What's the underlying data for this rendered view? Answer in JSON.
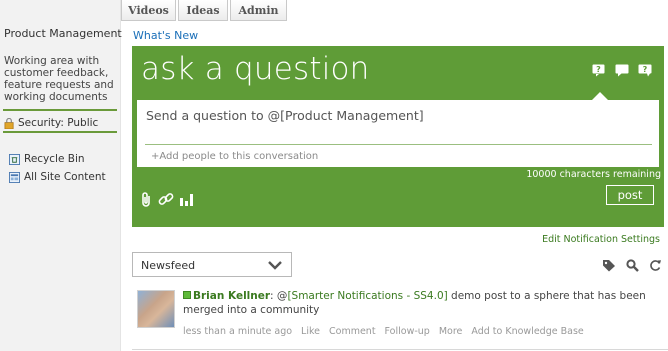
{
  "sidebar": {
    "title": "Product Management",
    "description": "Working area with customer feedback, feature requests and working documents",
    "security": "Security: Public",
    "links": [
      {
        "label": "Recycle Bin",
        "icon": "recycle-bin-icon"
      },
      {
        "label": "All Site Content",
        "icon": "site-content-icon"
      }
    ]
  },
  "tabs": [
    "Videos",
    "Ideas",
    "Admin"
  ],
  "whats_new": "What's New",
  "composer": {
    "heading": "ask a question",
    "placeholder": "Send a question to @[Product Management]",
    "add_people": "+Add people to this conversation",
    "chars_remaining": "10000 characters remaining",
    "post_label": "post",
    "type_icons": [
      "question-icon",
      "comment-icon",
      "question-comment-icon"
    ],
    "tool_icons": [
      "attachment-icon",
      "link-icon",
      "poll-icon"
    ],
    "color": "#5f9c37"
  },
  "edit_notification": "Edit Notification Settings",
  "feed": {
    "selected": "Newsfeed",
    "icons": [
      "tag-icon",
      "search-icon",
      "refresh-icon"
    ]
  },
  "post": {
    "author": "Brian Kellner",
    "separator": ": @",
    "mention": "[Smarter Notifications - SS4.0]",
    "text": " demo post to a sphere that has been merged into a community",
    "actions": [
      "less than a minute ago",
      "Like",
      "Comment",
      "Follow-up",
      "More",
      "Add to Knowledge Base"
    ]
  }
}
